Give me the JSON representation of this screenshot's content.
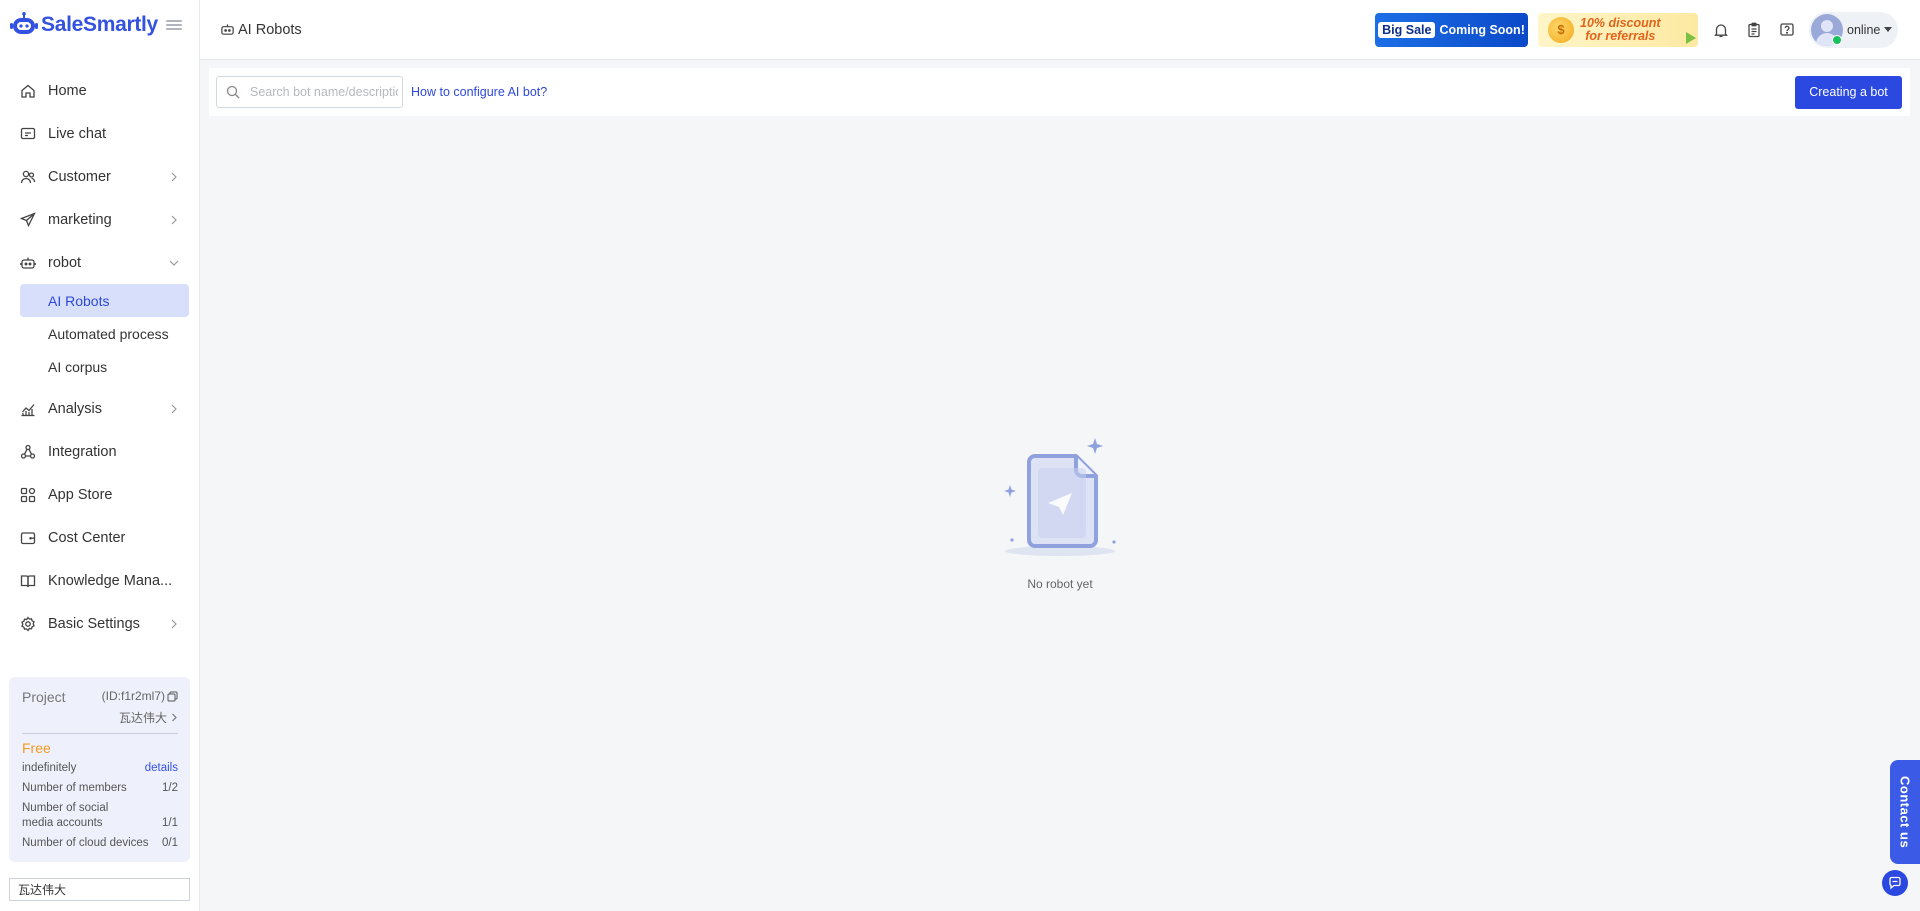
{
  "app": {
    "name": "SaleSmartly"
  },
  "header": {
    "breadcrumb": "AI Robots",
    "promo_big_sale": "Big Sale",
    "promo_coming_soon": "Coming Soon!",
    "promo_referral_line1": "10% discount",
    "promo_referral_line2": "for referrals",
    "status": "online"
  },
  "sidebar": {
    "items": [
      {
        "label": "Home",
        "icon": "home-icon"
      },
      {
        "label": "Live chat",
        "icon": "chat-icon"
      },
      {
        "label": "Customer",
        "icon": "users-icon",
        "chevron": "right"
      },
      {
        "label": "marketing",
        "icon": "paper-plane-icon",
        "chevron": "right"
      },
      {
        "label": "robot",
        "icon": "robot-icon",
        "chevron": "down"
      },
      {
        "label": "Analysis",
        "icon": "chart-icon",
        "chevron": "right"
      },
      {
        "label": "Integration",
        "icon": "integration-icon"
      },
      {
        "label": "App Store",
        "icon": "app-grid-icon"
      },
      {
        "label": "Cost Center",
        "icon": "wallet-icon"
      },
      {
        "label": "Knowledge Mana...",
        "icon": "book-icon"
      },
      {
        "label": "Basic Settings",
        "icon": "gear-icon",
        "chevron": "right"
      }
    ],
    "robot_sub": [
      {
        "label": "AI Robots",
        "active": true
      },
      {
        "label": "Automated process",
        "active": false
      },
      {
        "label": "AI corpus",
        "active": false
      }
    ]
  },
  "project": {
    "title": "Project",
    "id": "(ID:f1r2ml7)",
    "owner": "瓦达伟大",
    "plan": "Free",
    "duration": "indefinitely",
    "details_link": "details",
    "members_label": "Number of members",
    "members_value": "1/2",
    "social_label": "Number of social media accounts",
    "social_value": "1/1",
    "cloud_label": "Number of cloud devices",
    "cloud_value": "0/1"
  },
  "bottom_input": {
    "value": "瓦达伟大"
  },
  "toolbar": {
    "search_placeholder": "Search bot name/description",
    "help_link": "How to configure AI bot?",
    "create_button": "Creating a bot"
  },
  "empty_state": {
    "text": "No robot yet"
  },
  "contact": {
    "label": "Contact us"
  },
  "colors": {
    "accent": "#2b48e0",
    "active_bg": "#d8dffb",
    "plan_free": "#f39a1f",
    "online": "#18c15a"
  }
}
